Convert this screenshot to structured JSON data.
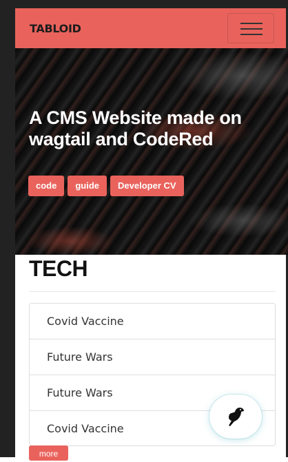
{
  "navbar": {
    "brand": "TABLOID",
    "menu_icon": "hamburger-menu-icon"
  },
  "hero": {
    "title": "A CMS Website made on wagtail and CodeRed",
    "tags": [
      "code",
      "guide",
      "Developer CV"
    ]
  },
  "section": {
    "title": "TECH",
    "items": [
      "Covid Vaccine",
      "Future Wars",
      "Future Wars",
      "Covid Vaccine"
    ],
    "more_label": "more"
  },
  "fab": {
    "icon": "wagtail-bird-icon"
  },
  "colors": {
    "accent": "#e9635c",
    "frame": "#222222"
  }
}
